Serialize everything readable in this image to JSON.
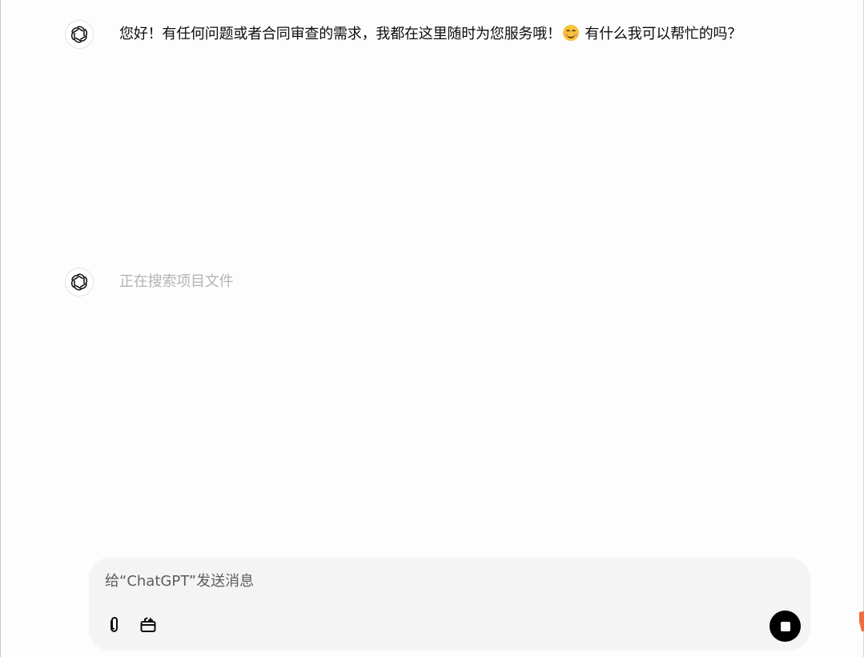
{
  "messages": [
    {
      "role": "assistant",
      "text_before_emoji": "您好！有任何问题或者合同审查的需求，我都在这里随时为您服务哦！",
      "emoji_icon": "smiling-face-icon",
      "text_after_emoji": " 有什么我可以帮忙的吗？"
    },
    {
      "role": "assistant",
      "status_text": "正在搜索项目文件"
    }
  ],
  "composer": {
    "placeholder": "给“ChatGPT”发送消息",
    "value": ""
  },
  "icons": {
    "avatar": "openai-logo-icon",
    "attach": "paperclip-icon",
    "tools": "toolbox-icon",
    "stop": "stop-icon"
  },
  "colors": {
    "background": "#fdfdfd",
    "composer_bg": "#f4f4f4",
    "pending_text": "#b4b4b4",
    "stop_button": "#000000",
    "corner_accent": "#f26b3a"
  }
}
